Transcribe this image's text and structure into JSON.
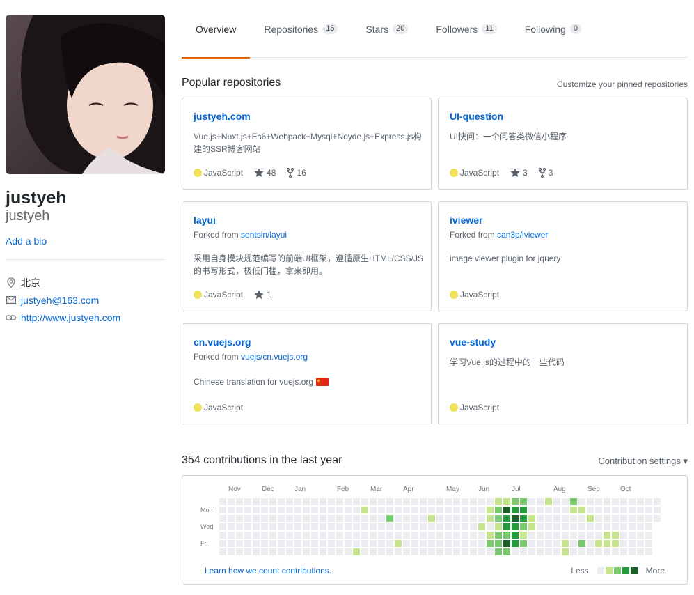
{
  "profile": {
    "full_name": "justyeh",
    "username": "justyeh",
    "add_bio": "Add a bio",
    "location": "北京",
    "email": "justyeh@163.com",
    "website": "http://www.justyeh.com"
  },
  "tabs": [
    {
      "label": "Overview",
      "count": ""
    },
    {
      "label": "Repositories",
      "count": "15"
    },
    {
      "label": "Stars",
      "count": "20"
    },
    {
      "label": "Followers",
      "count": "11"
    },
    {
      "label": "Following",
      "count": "0"
    }
  ],
  "popular": {
    "title": "Popular repositories",
    "customize": "Customize your pinned repositories",
    "repos": [
      {
        "name": "justyeh.com",
        "forked_prefix": "",
        "forked_from": "",
        "description": "Vue.js+Nuxt.js+Es6+Webpack+Mysql+Noyde.js+Express.js构建的SSR博客网站",
        "language": "JavaScript",
        "stars": "48",
        "forks": "16"
      },
      {
        "name": "UI-question",
        "forked_prefix": "",
        "forked_from": "",
        "description": "UI快问：一个问答类微信小程序",
        "language": "JavaScript",
        "stars": "3",
        "forks": "3"
      },
      {
        "name": "layui",
        "forked_prefix": "Forked from ",
        "forked_from": "sentsin/layui",
        "description": "采用自身模块规范编写的前端UI框架，遵循原生HTML/CSS/JS的书写形式，极低门槛，拿来即用。",
        "language": "JavaScript",
        "stars": "1",
        "forks": ""
      },
      {
        "name": "iviewer",
        "forked_prefix": "Forked from ",
        "forked_from": "can3p/iviewer",
        "description": "image viewer plugin for jquery",
        "language": "JavaScript",
        "stars": "",
        "forks": ""
      },
      {
        "name": "cn.vuejs.org",
        "forked_prefix": "Forked from ",
        "forked_from": "vuejs/cn.vuejs.org",
        "description": "Chinese translation for vuejs.org",
        "language": "JavaScript",
        "stars": "",
        "forks": ""
      },
      {
        "name": "vue-study",
        "forked_prefix": "",
        "forked_from": "",
        "description": "学习Vue.js的过程中的一些代码",
        "language": "JavaScript",
        "stars": "",
        "forks": ""
      }
    ]
  },
  "contributions": {
    "title": "354 contributions in the last year",
    "settings": "Contribution settings ▾",
    "months": [
      "Nov",
      "Dec",
      "Jan",
      "Feb",
      "Mar",
      "Apr",
      "May",
      "Jun",
      "Jul",
      "Aug",
      "Sep",
      "Oct"
    ],
    "day_labels": [
      "Mon",
      "Wed",
      "Fri"
    ],
    "learn": "Learn how we count contributions.",
    "less": "Less",
    "more": "More",
    "levels": [
      "#ebedf0",
      "#c6e48b",
      "#7bc96f",
      "#239a3b",
      "#196127"
    ]
  },
  "colors": {
    "javascript": "#f1e05a",
    "tab_underline": "#e36209",
    "link": "#0366d6"
  }
}
